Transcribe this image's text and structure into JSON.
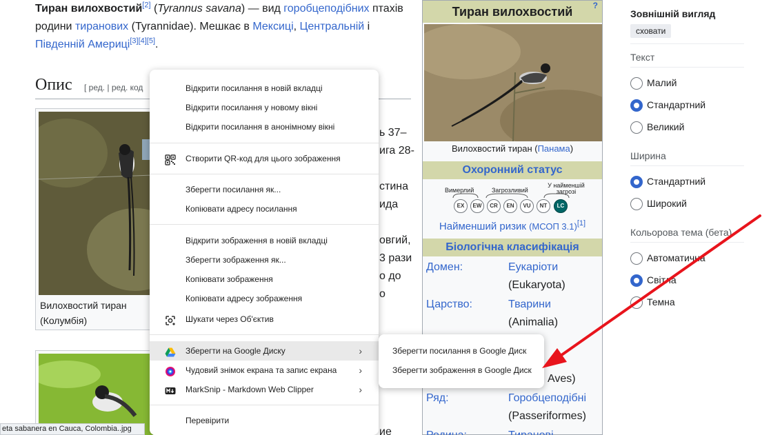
{
  "article": {
    "intro": {
      "title_bold": "Тиран вилохвостий",
      "ref1": "[2]",
      "latin": "Tyrannus savana",
      "t1": " (",
      "t2": ") — вид ",
      "link_order": "горобцеподібних",
      "t3": " птахів родини ",
      "link_family": "тиранових",
      "t4": " (Tyrannidae). Мешкає в ",
      "link_mexico": "Мексиці",
      "t5": ", ",
      "link_central": "Центральній",
      "t6": " і ",
      "link_south": "Південній Америці",
      "refs": "[3][4][5]",
      "t7": "."
    },
    "section_title": "Опис",
    "section_edit": "[ ред. | ред. код",
    "thumb1_caption": "Вилохвостий тиран (Колумбія)",
    "fragments": [
      "ь 37–",
      "ига 28-",
      "стина",
      "ида",
      "овгий,",
      "3 рази",
      "о до",
      "о",
      "ие"
    ]
  },
  "infobox": {
    "title": "Тиран вилохвостий",
    "help": "?",
    "image_caption_prefix": "Вилохвостий тиран (",
    "image_caption_link": "Панама",
    "image_caption_suffix": ")",
    "status_header": "Охоронний статус",
    "status_labels": {
      "extinct": "Вимерлий",
      "threatened": "Загрозливий",
      "least": "У найменшій загрозі"
    },
    "status_codes": [
      "EX",
      "EW",
      "CR",
      "EN",
      "VU",
      "NT",
      "LC"
    ],
    "status_text": "Найменший ризик",
    "status_source": "(МСОП 3.1)",
    "status_ref": "[1]",
    "classification_header": "Біологічна класифікація",
    "taxonomy": [
      {
        "rank": "Домен:",
        "value": "Еукаріоти",
        "latin": "(Eukaryota)"
      },
      {
        "rank": "Царство:",
        "value": "Тварини",
        "latin": "(Animalia)"
      },
      {
        "rank": "Ряд:",
        "value": "Горобцеподібні",
        "latin": "(Passeriformes)"
      },
      {
        "rank": "Родина:",
        "value": "Тиранові",
        "latin": ""
      }
    ],
    "class_latin_fragment": "Aves)"
  },
  "appearance": {
    "title": "Зовнішній вигляд",
    "hide": "сховати",
    "text_label": "Текст",
    "text_options": [
      "Малий",
      "Стандартний",
      "Великий"
    ],
    "text_selected": 1,
    "width_label": "Ширина",
    "width_options": [
      "Стандартний",
      "Широкий"
    ],
    "width_selected": 0,
    "theme_label": "Кольорова тема (бета)",
    "theme_options": [
      "Автоматична",
      "Світла",
      "Темна"
    ],
    "theme_selected": 1
  },
  "context_menu": {
    "items": [
      {
        "label": "Відкрити посилання в новій вкладці"
      },
      {
        "label": "Відкрити посилання у новому вікні"
      },
      {
        "label": "Відкрити посилання в анонімному вікні"
      },
      {
        "label": "Створити QR-код для цього зображення",
        "icon": "qr-code-icon"
      },
      {
        "label": "Зберегти посилання як..."
      },
      {
        "label": "Копіювати адресу посилання"
      },
      {
        "label": "Відкрити зображення в новій вкладці"
      },
      {
        "label": "Зберегти зображення як..."
      },
      {
        "label": "Копіювати зображення"
      },
      {
        "label": "Копіювати адресу зображення"
      },
      {
        "label": "Шукати через Об'єктив",
        "icon": "google-lens-icon"
      },
      {
        "label": "Зберегти на Google Диску",
        "icon": "google-drive-icon",
        "submenu": true,
        "highlighted": true
      },
      {
        "label": "Чудовий знімок екрана та запис екрана",
        "icon": "screenshot-extension-icon",
        "submenu": true
      },
      {
        "label": "MarkSnip - Markdown Web Clipper",
        "icon": "marksnip-icon",
        "submenu": true
      },
      {
        "label": "Перевірити"
      }
    ],
    "submenu_items": [
      {
        "label": "Зберегти посилання в Google Диск"
      },
      {
        "label": "Зберегти зображення в Google Диск"
      }
    ]
  },
  "file_tooltip": "eta sabanera en Cauca, Colombia..jpg",
  "colors": {
    "link": "#3366cc",
    "infobox_header": "#d3d7aa",
    "arrow": "#e8141c",
    "radio_on": "#3366cc"
  }
}
